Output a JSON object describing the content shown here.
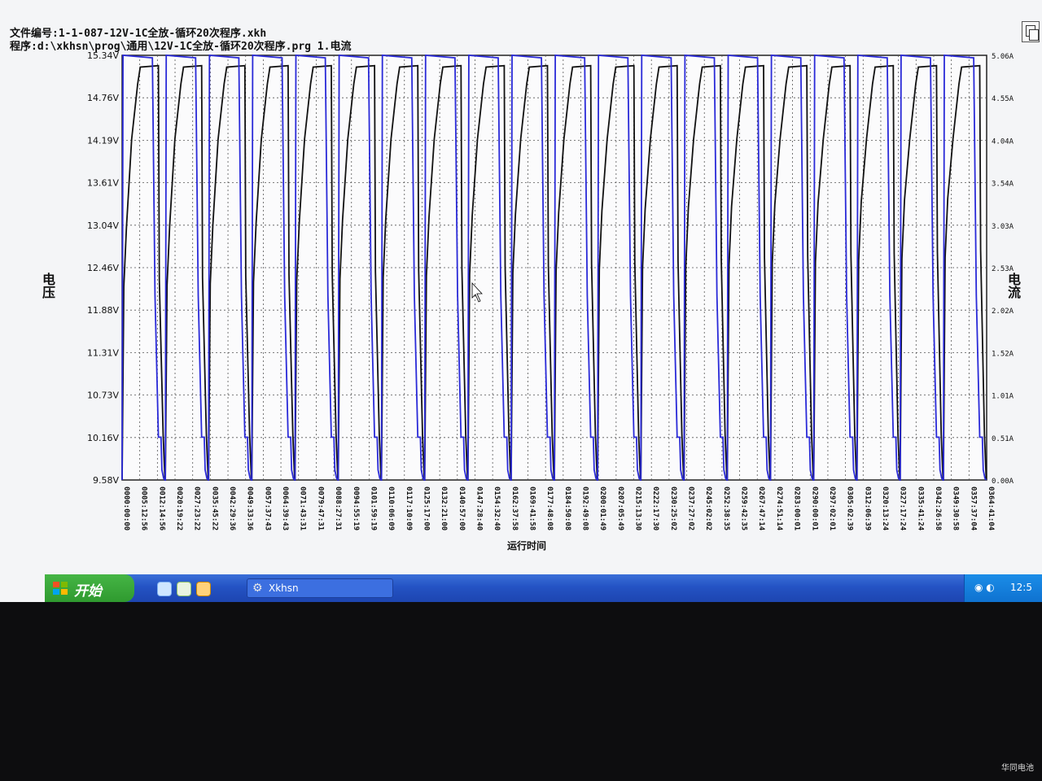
{
  "header": {
    "file_line": "文件编号:1-1-087-12V-1C全放-循环20次程序.xkh",
    "program_line": "程序:d:\\xkhsn\\prog\\通用\\12V-1C全放-循环20次程序.prg 1.电流"
  },
  "taskbar": {
    "start_label": "开始",
    "task_label": "Xkhsn",
    "clock": "12:5"
  },
  "watermark": "华同电池",
  "colors": {
    "voltage": "#111111",
    "current": "#2a2ad8",
    "grid": "#555555",
    "taskbar": "#2453c4",
    "start": "#3aa83a"
  },
  "chart_data": {
    "type": "line",
    "title": "",
    "xlabel": "运行时间",
    "ylabel": "电压",
    "ylabel_right": "电流",
    "y_ticks": [
      "15.34V",
      "14.76V",
      "14.19V",
      "13.61V",
      "13.04V",
      "12.46V",
      "11.88V",
      "11.31V",
      "10.73V",
      "10.16V",
      "9.58V"
    ],
    "y_right_ticks": [
      "5.06A",
      "4.55A",
      "4.04A",
      "3.54A",
      "3.03A",
      "2.53A",
      "2.02A",
      "1.52A",
      "1.01A",
      "0.51A",
      "0.00A"
    ],
    "x_ticks": [
      "0000:00:00",
      "0005:12:56",
      "0012:14:56",
      "0020:19:22",
      "0027:23:22",
      "0035:45:22",
      "0042:29:36",
      "0049:33:36",
      "0057:37:43",
      "0064:39:43",
      "0071:43:31",
      "0079:47:31",
      "0088:27:31",
      "0094:55:19",
      "0101:59:19",
      "0110:06:09",
      "0117:10:09",
      "0125:17:00",
      "0132:21:00",
      "0140:57:00",
      "0147:28:40",
      "0154:32:40",
      "0162:37:58",
      "0169:41:58",
      "0177:48:08",
      "0184:50:08",
      "0192:49:08",
      "0200:01:49",
      "0207:05:49",
      "0215:13:30",
      "0222:17:30",
      "0230:25:02",
      "0237:27:02",
      "0245:02:02",
      "0252:38:35",
      "0259:42:35",
      "0267:47:14",
      "0274:51:14",
      "0283:00:01",
      "0290:00:01",
      "0297:02:01",
      "0305:02:39",
      "0312:06:39",
      "0320:13:24",
      "0327:17:24",
      "0335:41:24",
      "0342:26:58",
      "0349:30:58",
      "0357:37:04",
      "0364:41:04"
    ],
    "ylim": [
      9.58,
      15.34
    ],
    "ylim_right": [
      0.0,
      5.06
    ],
    "grid": true,
    "cycles": 20,
    "series": [
      {
        "name": "电压",
        "axis": "left",
        "charge_plateau": 15.2,
        "discharge_start": 12.2,
        "rest_level": 9.58
      },
      {
        "name": "电流",
        "axis": "right",
        "charge_current": 0.51,
        "discharge_current": 5.06,
        "rest_level": 0.0
      }
    ]
  }
}
